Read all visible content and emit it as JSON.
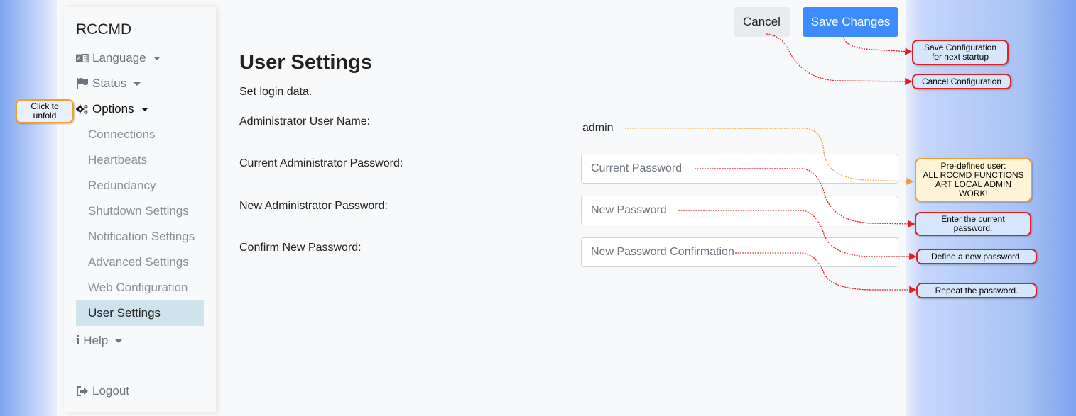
{
  "sidebar": {
    "brand": "RCCMD",
    "language": "Language",
    "status": "Status",
    "options": "Options",
    "help": "Help",
    "logout": "Logout",
    "items": [
      {
        "label": "Connections"
      },
      {
        "label": "Heartbeats"
      },
      {
        "label": "Redundancy"
      },
      {
        "label": "Shutdown Settings"
      },
      {
        "label": "Notification Settings"
      },
      {
        "label": "Advanced Settings"
      },
      {
        "label": "Web Configuration"
      },
      {
        "label": "User Settings",
        "active": true
      }
    ]
  },
  "toolbar": {
    "cancel_label": "Cancel",
    "save_label": "Save Changes"
  },
  "page": {
    "title": "User Settings",
    "subtitle": "Set login data."
  },
  "form": {
    "admin_user_label": "Administrator User Name:",
    "admin_user_value": "admin",
    "current_pw_label": "Current Administrator Password:",
    "current_pw_placeholder": "Current Password",
    "new_pw_label": "New Administrator Password:",
    "new_pw_placeholder": "New Password",
    "confirm_pw_label": "Confirm New Password:",
    "confirm_pw_placeholder": "New Password Confirmation"
  },
  "callouts": {
    "click_to_unfold_1": "Click to",
    "click_to_unfold_2": "unfold",
    "save_config_1": "Save Configuration",
    "save_config_2": "for next startup",
    "cancel_config": "Cancel Configuration",
    "predefined_1": "Pre-defined user:",
    "predefined_2": "ALL RCCMD FUNCTIONS",
    "predefined_3": "ART LOCAL ADMIN",
    "predefined_4": "WORK!",
    "enter_current_1": "Enter the current",
    "enter_current_2": "password.",
    "define_new": "Define a new password.",
    "repeat": "Repeat the password."
  },
  "colors": {
    "accent": "#3c8cff",
    "active_bg": "#cfe3ec",
    "callout_red": "#e02020",
    "callout_orange": "#f0a030"
  }
}
